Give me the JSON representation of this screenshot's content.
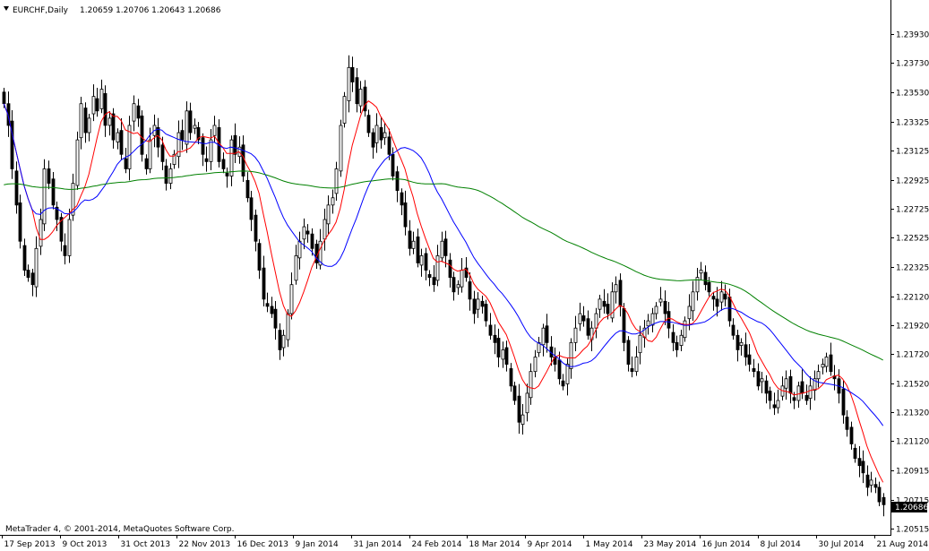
{
  "window": {
    "symbol_label": "EURCHF,Daily",
    "ohlc_label": "1.20659 1.20706 1.20643 1.20686",
    "copyright": "MetaTrader 4, © 2001-2014, MetaQuotes Software Corp.",
    "current_price_label": "1.20686"
  },
  "chart_data": {
    "type": "candlestick",
    "symbol": "EURCHF",
    "timeframe": "Daily",
    "x_tick_labels": [
      "17 Sep 2013",
      "9 Oct 2013",
      "31 Oct 2013",
      "22 Nov 2013",
      "16 Dec 2013",
      "9 Jan 2014",
      "31 Jan 2014",
      "24 Feb 2014",
      "18 Mar 2014",
      "9 Apr 2014",
      "1 May 2014",
      "23 May 2014",
      "16 Jun 2014",
      "8 Jul 2014",
      "30 Jul 2014",
      "21 Aug 2014"
    ],
    "y_tick_labels": [
      "1.23930",
      "1.23730",
      "1.23530",
      "1.23325",
      "1.23125",
      "1.22925",
      "1.22725",
      "1.22525",
      "1.22325",
      "1.22120",
      "1.21920",
      "1.21720",
      "1.21520",
      "1.21320",
      "1.21120",
      "1.20915",
      "1.20715",
      "1.20515"
    ],
    "ylim": [
      1.20515,
      1.2403
    ],
    "grid": false,
    "current_price": 1.20686,
    "closes": [
      1.2345,
      1.233,
      1.23,
      1.2275,
      1.225,
      1.223,
      1.2225,
      1.222,
      1.2245,
      1.2265,
      1.23,
      1.229,
      1.2275,
      1.2265,
      1.225,
      1.224,
      1.2265,
      1.229,
      1.232,
      1.2345,
      1.2325,
      1.2335,
      1.235,
      1.234,
      1.2355,
      1.233,
      1.2335,
      1.232,
      1.2325,
      1.231,
      1.23,
      1.233,
      1.2345,
      1.2335,
      1.231,
      1.23,
      1.232,
      1.233,
      1.2315,
      1.2305,
      1.229,
      1.23,
      1.231,
      1.2325,
      1.232,
      1.234,
      1.2325,
      1.233,
      1.232,
      1.231,
      1.2305,
      1.232,
      1.233,
      1.2305,
      1.23,
      1.2295,
      1.232,
      1.231,
      1.2315,
      1.2295,
      1.228,
      1.2265,
      1.225,
      1.223,
      1.221,
      1.2205,
      1.22,
      1.219,
      1.2175,
      1.2185,
      1.22,
      1.222,
      1.224,
      1.225,
      1.226,
      1.2255,
      1.2245,
      1.2235,
      1.225,
      1.2265,
      1.2275,
      1.228,
      1.23,
      1.233,
      1.235,
      1.237,
      1.236,
      1.2345,
      1.2355,
      1.234,
      1.2325,
      1.2315,
      1.233,
      1.232,
      1.2325,
      1.231,
      1.2295,
      1.2285,
      1.2275,
      1.226,
      1.2245,
      1.225,
      1.2235,
      1.224,
      1.223,
      1.2225,
      1.222,
      1.224,
      1.225,
      1.224,
      1.2225,
      1.2215,
      1.222,
      1.223,
      1.2225,
      1.221,
      1.22,
      1.221,
      1.2205,
      1.2195,
      1.2185,
      1.218,
      1.217,
      1.2175,
      1.2165,
      1.215,
      1.214,
      1.2125,
      1.213,
      1.2145,
      1.216,
      1.217,
      1.218,
      1.219,
      1.218,
      1.217,
      1.2165,
      1.2155,
      1.215,
      1.2165,
      1.218,
      1.219,
      1.22,
      1.2195,
      1.2185,
      1.219,
      1.22,
      1.221,
      1.2205,
      1.22,
      1.2215,
      1.222,
      1.2205,
      1.218,
      1.2165,
      1.216,
      1.217,
      1.2185,
      1.219,
      1.2195,
      1.22,
      1.2205,
      1.221,
      1.22,
      1.219,
      1.218,
      1.2175,
      1.2185,
      1.2195,
      1.2205,
      1.2215,
      1.2225,
      1.223,
      1.222,
      1.2215,
      1.221,
      1.2205,
      1.2215,
      1.221,
      1.2195,
      1.2185,
      1.2175,
      1.218,
      1.217,
      1.2165,
      1.216,
      1.215,
      1.2155,
      1.2145,
      1.214,
      1.2135,
      1.214,
      1.215,
      1.2155,
      1.2145,
      1.214,
      1.215,
      1.2145,
      1.214,
      1.215,
      1.2155,
      1.216,
      1.2165,
      1.217,
      1.216,
      1.2155,
      1.2145,
      1.213,
      1.212,
      1.211,
      1.21,
      1.2095,
      1.209,
      1.208,
      1.2085,
      1.208,
      1.207,
      1.2068
    ],
    "moving_averages": [
      {
        "color": "#ff0000",
        "period": 8
      },
      {
        "color": "#0000ff",
        "period": 21
      },
      {
        "color": "#008000",
        "period": 100
      }
    ]
  }
}
